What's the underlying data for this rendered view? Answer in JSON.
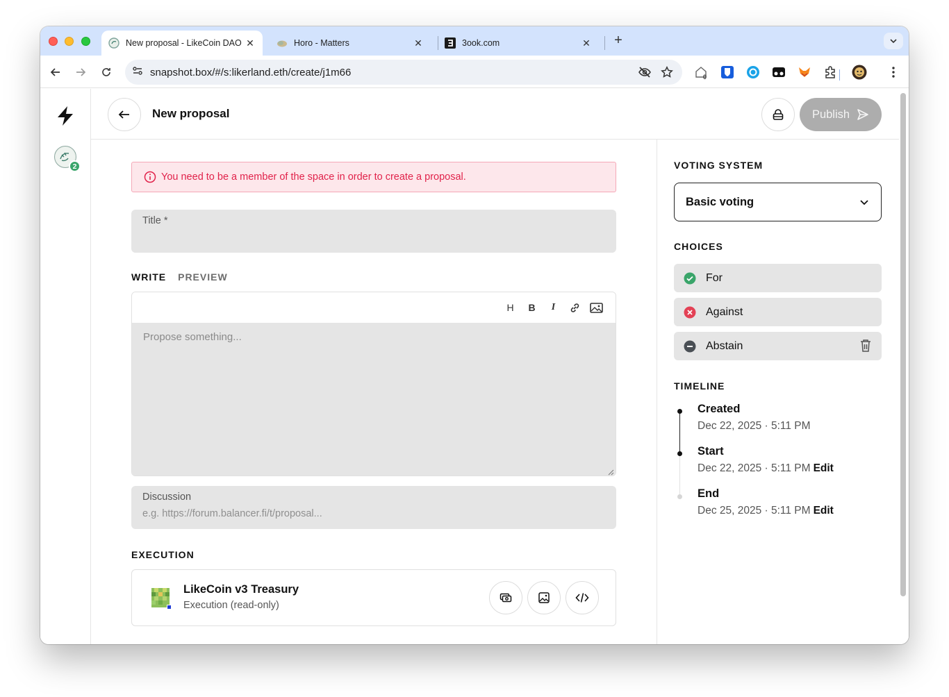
{
  "browser": {
    "tabs": [
      {
        "title": "New proposal - LikeCoin DAO",
        "active": true
      },
      {
        "title": "Horo - Matters",
        "active": false
      },
      {
        "title": "3ook.com",
        "active": false
      }
    ],
    "url": "snapshot.box/#/s:likerland.eth/create/j1m66",
    "extension_badge": "0"
  },
  "header": {
    "title": "New proposal",
    "publish_label": "Publish"
  },
  "space": {
    "badge_count": "2"
  },
  "form": {
    "alert": "You need to be a member of the space in order to create a proposal.",
    "title_label": "Title *",
    "tabs": {
      "write": "WRITE",
      "preview": "PREVIEW"
    },
    "toolbar": {
      "heading": "H",
      "bold": "B",
      "italic": "I"
    },
    "body_placeholder": "Propose something...",
    "discussion_label": "Discussion",
    "discussion_placeholder": "e.g. https://forum.balancer.fi/t/proposal..."
  },
  "execution": {
    "heading": "EXECUTION",
    "name": "LikeCoin v3 Treasury",
    "subtitle": "Execution (read-only)"
  },
  "sidebar": {
    "voting_heading": "VOTING SYSTEM",
    "voting_value": "Basic voting",
    "choices_heading": "CHOICES",
    "choices": [
      {
        "label": "For",
        "icon": "check-circle-icon",
        "color": "#3aa56a"
      },
      {
        "label": "Against",
        "icon": "x-circle-icon",
        "color": "#e34155"
      },
      {
        "label": "Abstain",
        "icon": "minus-circle-icon",
        "color": "#4a4f55"
      }
    ],
    "timeline_heading": "TIMELINE",
    "timeline": [
      {
        "label": "Created",
        "date": "Dec 22, 2025 · 5:11 PM"
      },
      {
        "label": "Start",
        "date": "Dec 22, 2025 · 5:11 PM",
        "edit": "Edit"
      },
      {
        "label": "End",
        "date": "Dec 25, 2025 · 5:11 PM",
        "edit": "Edit"
      }
    ]
  }
}
